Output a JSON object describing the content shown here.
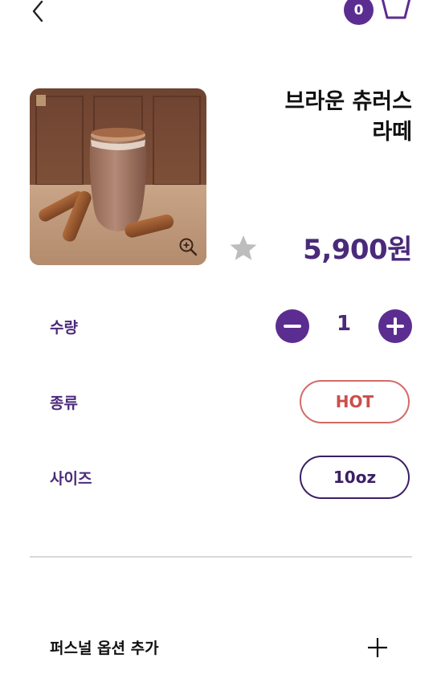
{
  "header": {
    "back_icon": "chevron-left-icon",
    "cart_count": "0",
    "cart_icon": "basket-icon"
  },
  "product": {
    "name_line1": "브라운 츄러스",
    "name_line2": "라떼",
    "price": "5,900원",
    "image_description_icon": "zoom-in-icon",
    "favorite_icon": "star-icon"
  },
  "options": {
    "quantity_label": "수량",
    "quantity_value": "1",
    "type_label": "종류",
    "type_value": "HOT",
    "size_label": "사이즈",
    "size_value": "10oz"
  },
  "personal_option": {
    "label": "퍼스널 옵션 추가",
    "icon": "plus-icon"
  },
  "colors": {
    "brand_purple": "#5c2d91",
    "price_purple": "#4a2a7a",
    "hot_red": "#c94f4b",
    "divider": "#d9d9d9"
  }
}
